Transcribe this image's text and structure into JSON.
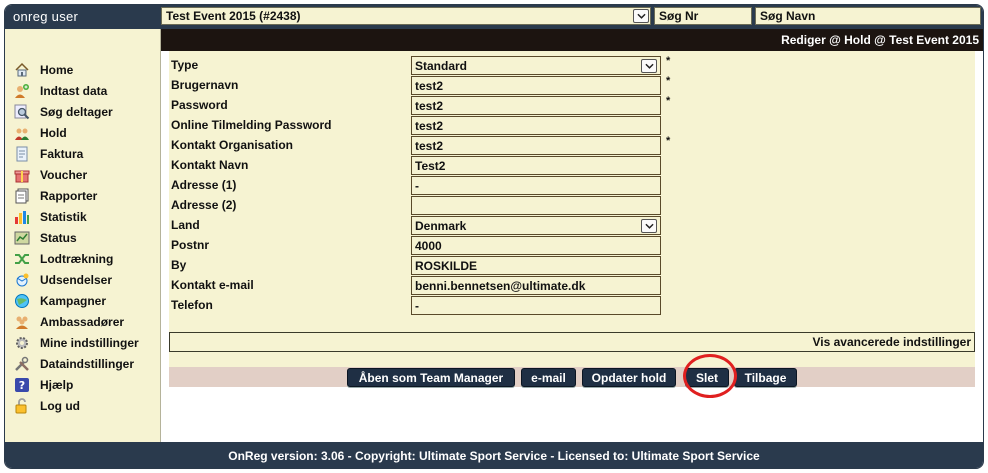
{
  "header": {
    "app_title": "onreg user",
    "event_select": "Test Event 2015 (#2438)",
    "search_nr": "Søg Nr",
    "search_navn": "Søg Navn"
  },
  "sidebar": {
    "items": [
      {
        "label": "Home",
        "icon": "home-icon"
      },
      {
        "label": "Indtast data",
        "icon": "add-user-icon"
      },
      {
        "label": "Søg deltager",
        "icon": "search-icon"
      },
      {
        "label": "Hold",
        "icon": "team-icon"
      },
      {
        "label": "Faktura",
        "icon": "invoice-icon"
      },
      {
        "label": "Voucher",
        "icon": "gift-icon"
      },
      {
        "label": "Rapporter",
        "icon": "reports-icon"
      },
      {
        "label": "Statistik",
        "icon": "bar-chart-icon"
      },
      {
        "label": "Status",
        "icon": "status-icon"
      },
      {
        "label": "Lodtrækning",
        "icon": "shuffle-icon"
      },
      {
        "label": "Udsendelser",
        "icon": "broadcast-icon"
      },
      {
        "label": "Kampagner",
        "icon": "campaign-icon"
      },
      {
        "label": "Ambassadører",
        "icon": "ambassador-icon"
      },
      {
        "label": "Mine indstillinger",
        "icon": "gear-icon"
      },
      {
        "label": "Dataindstillinger",
        "icon": "tools-icon"
      },
      {
        "label": "Hjælp",
        "icon": "help-icon"
      },
      {
        "label": "Log ud",
        "icon": "lock-icon"
      }
    ]
  },
  "main": {
    "title": "Rediger @ Hold @ Test Event 2015",
    "fields": [
      {
        "label": "Type",
        "value": "Standard",
        "kind": "select",
        "required": true
      },
      {
        "label": "Brugernavn",
        "value": "test2",
        "kind": "text",
        "required": true
      },
      {
        "label": "Password",
        "value": "test2",
        "kind": "text",
        "required": true
      },
      {
        "label": "Online Tilmelding Password",
        "value": "test2",
        "kind": "text",
        "required": false
      },
      {
        "label": "Kontakt Organisation",
        "value": "test2",
        "kind": "text",
        "required": true
      },
      {
        "label": "Kontakt Navn",
        "value": "Test2",
        "kind": "text",
        "required": false
      },
      {
        "label": "Adresse (1)",
        "value": "-",
        "kind": "text",
        "required": false
      },
      {
        "label": "Adresse (2)",
        "value": "",
        "kind": "text",
        "required": false
      },
      {
        "label": "Land",
        "value": "Denmark",
        "kind": "select",
        "required": false
      },
      {
        "label": "Postnr",
        "value": "4000",
        "kind": "text",
        "required": false
      },
      {
        "label": "By",
        "value": "ROSKILDE",
        "kind": "text",
        "required": false
      },
      {
        "label": "Kontakt e-mail",
        "value": "benni.bennetsen@ultimate.dk",
        "kind": "text",
        "required": false
      },
      {
        "label": "Telefon",
        "value": "-",
        "kind": "text",
        "required": false
      }
    ],
    "required_marker": "*",
    "advanced_link": "Vis avancerede indstillinger",
    "buttons": {
      "open_team_manager": "Åben som Team Manager",
      "email": "e-mail",
      "update": "Opdater hold",
      "delete": "Slet",
      "back": "Tilbage"
    }
  },
  "footer": {
    "text": "OnReg version: 3.06 - Copyright: Ultimate Sport Service - Licensed to: Ultimate Sport Service"
  },
  "colors": {
    "topbar": "#2a3a4d",
    "panel": "#f6f3d2",
    "button": "#1f2f44",
    "highlight_ring": "#e02020"
  }
}
